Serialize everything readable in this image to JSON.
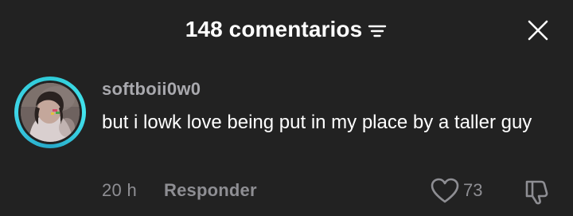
{
  "header": {
    "title": "148 comentarios",
    "filter_icon": "filter-icon",
    "close_icon": "close-icon"
  },
  "comment": {
    "username": "softboii0w0",
    "text": "but i lowk love being put in my place by a taller guy",
    "timestamp": "20 h",
    "reply_label": "Responder",
    "like_count": "73",
    "avatar_ring_color": "#2ec9d6",
    "like_icon": "heart-outline-icon",
    "dislike_icon": "thumbs-down-icon"
  },
  "colors": {
    "background": "#222222",
    "primary_text": "#ffffff",
    "secondary_text": "#8e8e93",
    "username_text": "#a9a9ae"
  }
}
